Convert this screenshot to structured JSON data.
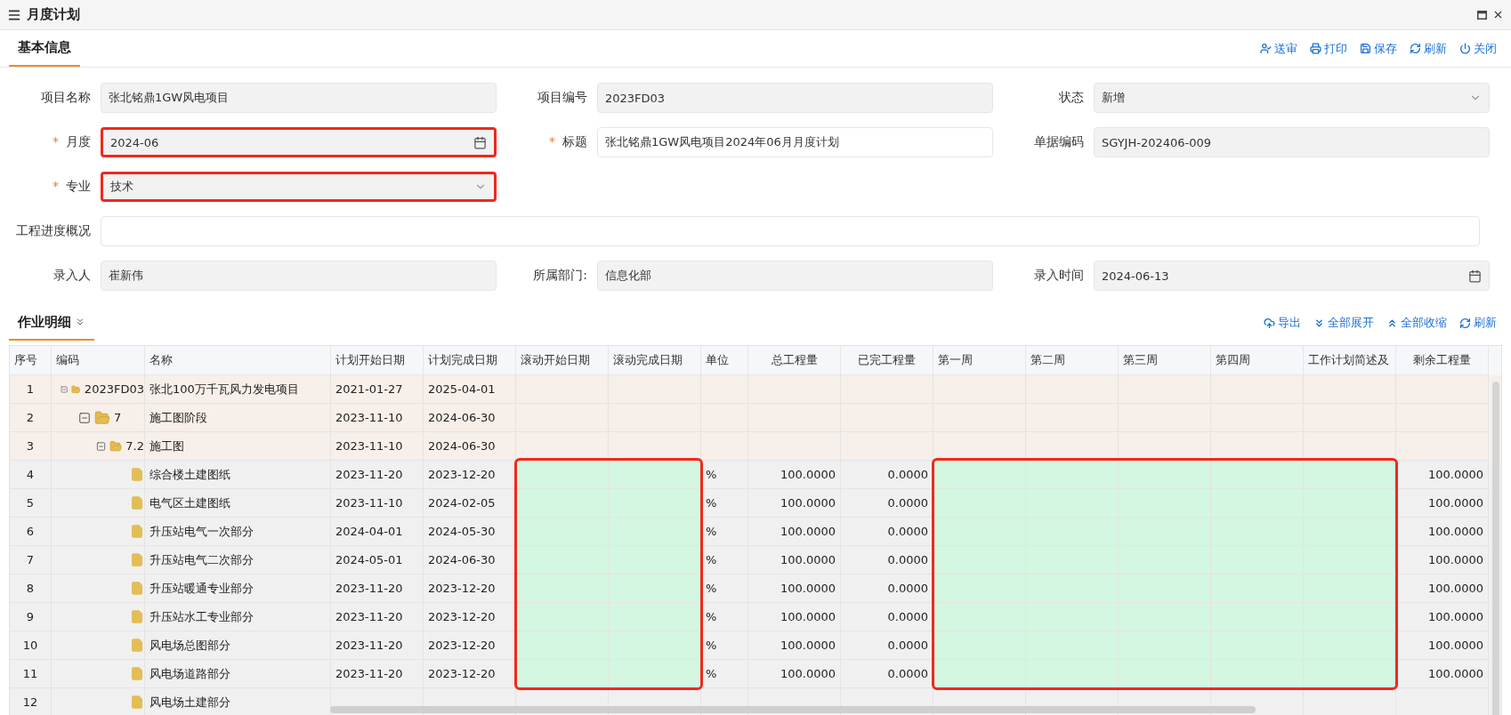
{
  "window": {
    "title": "月度计划"
  },
  "tabs": [
    {
      "label": "基本信息",
      "selected": true
    }
  ],
  "toolbar": [
    {
      "kind": "submit",
      "label": "送审"
    },
    {
      "kind": "print",
      "label": "打印"
    },
    {
      "kind": "save",
      "label": "保存"
    },
    {
      "kind": "refresh",
      "label": "刷新"
    },
    {
      "kind": "close",
      "label": "关闭"
    }
  ],
  "form": {
    "rows": [
      [
        {
          "label": "项目名称",
          "value": "张北铭鼎1GW风电项目",
          "kind": "text",
          "readonly": true,
          "highlighted": false
        },
        {
          "label": "项目编号",
          "value": "2023FD03",
          "kind": "text",
          "readonly": true,
          "highlighted": false
        },
        {
          "label": "状态",
          "value": "新增",
          "kind": "select",
          "readonly": true,
          "highlighted": false
        }
      ],
      [
        {
          "mark": "*",
          "label": "月度",
          "value": "2024-06",
          "kind": "date",
          "readonly": true,
          "highlighted": true
        },
        {
          "mark": "*",
          "label": "标题",
          "value": "张北铭鼎1GW风电项目2024年06月月度计划",
          "kind": "text",
          "readonly": false,
          "highlighted": false
        },
        {
          "label": "单据编码",
          "value": "SGYJH-202406-009",
          "kind": "text",
          "readonly": true,
          "highlighted": false
        }
      ],
      [
        {
          "mark": "*",
          "label": "专业",
          "value": "技术",
          "kind": "select",
          "readonly": true,
          "highlighted": true
        }
      ],
      [
        {
          "label": "工程进度概况",
          "kind": "wide",
          "readonly": false,
          "highlighted": false
        }
      ],
      [
        {
          "label": "录入人",
          "value": "崔新伟",
          "kind": "text",
          "readonly": true,
          "highlighted": false
        },
        {
          "label": "所属部门:",
          "value": "信息化部",
          "kind": "text",
          "readonly": true,
          "highlighted": false
        },
        {
          "label": "录入时间",
          "value": "2024-06-13",
          "kind": "date",
          "readonly": true,
          "highlighted": false
        }
      ]
    ]
  },
  "details": {
    "title": "作业明细",
    "selected": true,
    "toolbar": [
      {
        "kind": "export",
        "label": "导出"
      },
      {
        "kind": "expand",
        "label": "全部展开"
      },
      {
        "kind": "collapse",
        "label": "全部收缩"
      },
      {
        "kind": "refresh",
        "label": "刷新"
      }
    ],
    "columns": [
      {
        "label": "序号",
        "numeric": false,
        "editable": false
      },
      {
        "label": "编码",
        "numeric": false,
        "editable": false
      },
      {
        "label": "名称",
        "numeric": false,
        "editable": false
      },
      {
        "label": "计划开始日期",
        "numeric": false,
        "editable": false
      },
      {
        "label": "计划完成日期",
        "numeric": false,
        "editable": false
      },
      {
        "label": "滚动开始日期",
        "numeric": false,
        "editable": true
      },
      {
        "label": "滚动完成日期",
        "numeric": false,
        "editable": true
      },
      {
        "label": "单位",
        "numeric": false,
        "editable": false
      },
      {
        "label": "总工程量",
        "numeric": true,
        "editable": false
      },
      {
        "label": "已完工程量",
        "numeric": true,
        "editable": false
      },
      {
        "label": "第一周",
        "numeric": false,
        "editable": true
      },
      {
        "label": "第二周",
        "numeric": false,
        "editable": true
      },
      {
        "label": "第三周",
        "numeric": false,
        "editable": true
      },
      {
        "label": "第四周",
        "numeric": false,
        "editable": true
      },
      {
        "label": "工作计划简述及",
        "numeric": false,
        "editable": true
      },
      {
        "label": "剩余工程量",
        "numeric": true,
        "editable": false
      }
    ],
    "rows": [
      {
        "expanded": true,
        "editable": false,
        "cells": [
          "1",
          "2023FD03",
          "张北100万千瓦风力发电项目",
          "2021-01-27",
          "2025-04-01",
          null,
          null,
          null,
          null,
          null,
          null,
          null,
          null,
          null,
          null,
          null
        ],
        "children": [
          {
            "expanded": true,
            "editable": false,
            "cells": [
              "2",
              "7",
              "施工图阶段",
              "2023-11-10",
              "2024-06-30",
              null,
              null,
              null,
              null,
              null,
              null,
              null,
              null,
              null,
              null,
              null
            ],
            "children": [
              {
                "expanded": true,
                "editable": false,
                "cells": [
                  "3",
                  "7.2",
                  "施工图",
                  "2023-11-10",
                  "2024-06-30",
                  null,
                  null,
                  null,
                  null,
                  null,
                  null,
                  null,
                  null,
                  null,
                  null,
                  null
                ],
                "children": [
                  {
                    "editable": true,
                    "cells": [
                      "4",
                      null,
                      "综合楼土建图纸",
                      "2023-11-20",
                      "2023-12-20",
                      null,
                      null,
                      "%",
                      "100.0000",
                      "0.0000",
                      null,
                      null,
                      null,
                      null,
                      null,
                      "100.0000"
                    ]
                  },
                  {
                    "editable": true,
                    "cells": [
                      "5",
                      null,
                      "电气区土建图纸",
                      "2023-11-10",
                      "2024-02-05",
                      null,
                      null,
                      "%",
                      "100.0000",
                      "0.0000",
                      null,
                      null,
                      null,
                      null,
                      null,
                      "100.0000"
                    ]
                  },
                  {
                    "editable": true,
                    "cells": [
                      "6",
                      null,
                      "升压站电气一次部分",
                      "2024-04-01",
                      "2024-05-30",
                      null,
                      null,
                      "%",
                      "100.0000",
                      "0.0000",
                      null,
                      null,
                      null,
                      null,
                      null,
                      "100.0000"
                    ]
                  },
                  {
                    "editable": true,
                    "cells": [
                      "7",
                      null,
                      "升压站电气二次部分",
                      "2024-05-01",
                      "2024-06-30",
                      null,
                      null,
                      "%",
                      "100.0000",
                      "0.0000",
                      null,
                      null,
                      null,
                      null,
                      null,
                      "100.0000"
                    ]
                  },
                  {
                    "editable": true,
                    "cells": [
                      "8",
                      null,
                      "升压站暖通专业部分",
                      "2023-11-20",
                      "2023-12-20",
                      null,
                      null,
                      "%",
                      "100.0000",
                      "0.0000",
                      null,
                      null,
                      null,
                      null,
                      null,
                      "100.0000"
                    ]
                  },
                  {
                    "editable": true,
                    "cells": [
                      "9",
                      null,
                      "升压站水工专业部分",
                      "2023-11-20",
                      "2023-12-20",
                      null,
                      null,
                      "%",
                      "100.0000",
                      "0.0000",
                      null,
                      null,
                      null,
                      null,
                      null,
                      "100.0000"
                    ]
                  },
                  {
                    "editable": true,
                    "cells": [
                      "10",
                      null,
                      "风电场总图部分",
                      "2023-11-20",
                      "2023-12-20",
                      null,
                      null,
                      "%",
                      "100.0000",
                      "0.0000",
                      null,
                      null,
                      null,
                      null,
                      null,
                      "100.0000"
                    ]
                  },
                  {
                    "editable": true,
                    "cells": [
                      "11",
                      null,
                      "风电场道路部分",
                      "2023-11-20",
                      "2023-12-20",
                      null,
                      null,
                      "%",
                      "100.0000",
                      "0.0000",
                      null,
                      null,
                      null,
                      null,
                      null,
                      "100.0000"
                    ]
                  },
                  {
                    "editable": false,
                    "cells": [
                      "12",
                      null,
                      "风电场土建部分",
                      null,
                      null,
                      null,
                      null,
                      null,
                      null,
                      null,
                      null,
                      null,
                      null,
                      null,
                      null,
                      null
                    ]
                  }
                ]
              }
            ]
          }
        ]
      }
    ]
  }
}
